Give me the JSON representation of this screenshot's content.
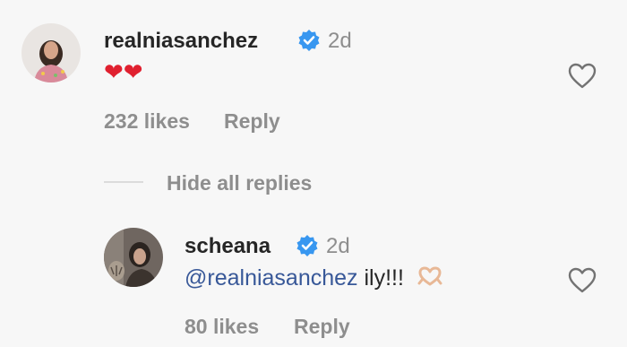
{
  "comments": [
    {
      "username": "realniasanchez",
      "verified_icon": "verified-badge-icon",
      "time": "2d",
      "text": "❤❤",
      "likes_label": "232 likes",
      "reply_label": "Reply",
      "like_icon": "heart-outline-icon"
    }
  ],
  "replies_toggle": {
    "label": "Hide all replies"
  },
  "replies": [
    {
      "username": "scheana",
      "verified_icon": "verified-badge-icon",
      "time": "2d",
      "mention": "@realniasanchez",
      "text": " ily!!!",
      "emoji_icon": "heart-hands-emoji",
      "likes_label": "80 likes",
      "reply_label": "Reply",
      "like_icon": "heart-outline-icon"
    }
  ],
  "colors": {
    "verified": "#3897f0",
    "mention": "#385898",
    "heart_emoji": "#e0202f",
    "muted": "#8e8e8e"
  }
}
